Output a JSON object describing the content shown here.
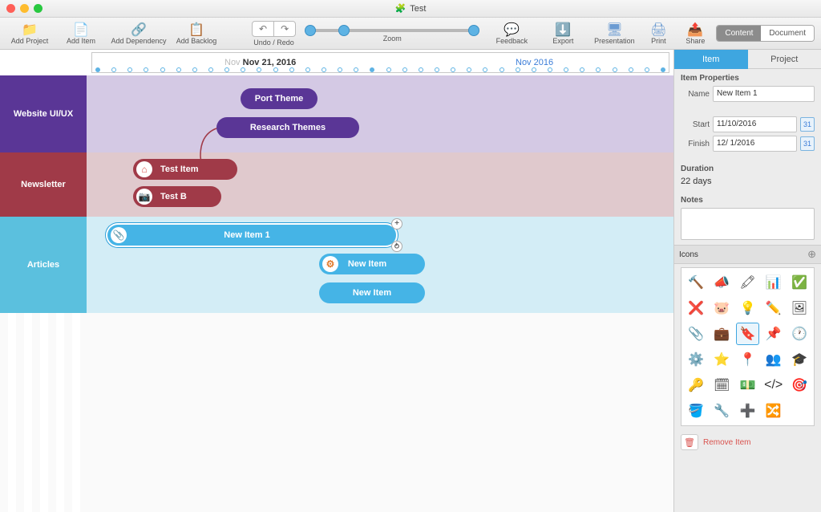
{
  "window": {
    "title": "Test"
  },
  "toolbar": {
    "add_project": "Add Project",
    "add_item": "Add Item",
    "add_dependency": "Add Dependency",
    "add_backlog": "Add Backlog",
    "undo_redo": "Undo / Redo",
    "zoom": "Zoom",
    "feedback": "Feedback",
    "export": "Export",
    "presentation": "Presentation",
    "print": "Print",
    "share": "Share",
    "content": "Content",
    "document": "Document"
  },
  "timeline": {
    "date_prefix": "Nov",
    "date_main": "Nov 21, 2016",
    "month_label": "Nov 2016"
  },
  "lanes": {
    "website": "Website UI/UX",
    "newsletter": "Newsletter",
    "articles": "Articles"
  },
  "items": {
    "port_theme": "Port Theme",
    "research_themes": "Research Themes",
    "test_item": "Test Item",
    "test_b": "Test B",
    "new_item_1": "New Item 1",
    "new_item": "New Item",
    "new_item_b": "New Item"
  },
  "sidebar": {
    "tab_item": "Item",
    "tab_project": "Project",
    "section_props": "Item Properties",
    "name_label": "Name",
    "name_value": "New Item 1",
    "start_label": "Start",
    "start_value": "11/10/2016",
    "finish_label": "Finish",
    "finish_value": "12/ 1/2016",
    "duration_label": "Duration",
    "duration_value": "22 days",
    "notes_label": "Notes",
    "icons_label": "Icons",
    "remove": "Remove Item"
  },
  "icons": [
    "🔨",
    "📣",
    "🖍",
    "📊",
    "✅",
    "❌",
    "🐷",
    "💡",
    "✏️",
    "🖼",
    "📎",
    "💼",
    "🔖",
    "📌",
    "🕐",
    "⚙️",
    "⭐",
    "📍",
    "👥",
    "🎓",
    "🔑",
    "🗓",
    "💵",
    "</>",
    "🎯",
    "🪣",
    "🔧",
    "➕",
    "🔀"
  ]
}
